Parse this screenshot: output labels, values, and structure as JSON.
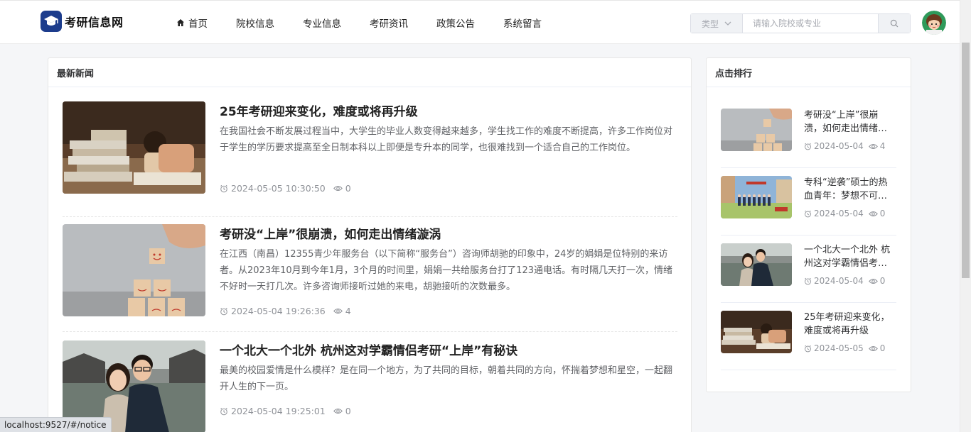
{
  "header": {
    "logo_text": "考研信息网",
    "nav": [
      {
        "label": "首页",
        "active": true
      },
      {
        "label": "院校信息"
      },
      {
        "label": "专业信息"
      },
      {
        "label": "考研资讯"
      },
      {
        "label": "政策公告"
      },
      {
        "label": "系统留言"
      }
    ],
    "search": {
      "type_label": "类型",
      "placeholder": "请输入院校或专业"
    }
  },
  "news": {
    "heading": "最新新闻",
    "items": [
      {
        "title": "25年考研迎来变化，难度或将再升级",
        "desc": "在我国社会不断发展过程当中，大学生的毕业人数变得越来越多，学生找工作的难度不断提高，许多工作岗位对于学生的学历要求提高至全日制本科以上即便是专升本的同学，也很难找到一个适合自己的工作岗位。",
        "time": "2024-05-05 10:30:50",
        "views": "0"
      },
      {
        "title": "考研没“上岸”很崩溃，如何走出情绪漩涡",
        "desc": "在江西（南昌）12355青少年服务台（以下简称“服务台”）咨询师胡驰的印象中，24岁的娟娟是位特别的来访者。从2023年10月到今年1月，3个月的时间里，娟娟一共给服务台打了123通电话。有时隔几天打一次，情绪不好时一天打几次。许多咨询师接听过她的来电，胡驰接听的次数最多。",
        "time": "2024-05-04 19:26:36",
        "views": "4"
      },
      {
        "title": "一个北大一个北外 杭州这对学霸情侣考研“上岸”有秘诀",
        "desc": "最美的校园爱情是什么模样？是在同一个地方，为了共同的目标，朝着共同的方向，怀揣着梦想和星空，一起翻开人生的下一页。",
        "time": "2024-05-04 19:25:01",
        "views": "0"
      }
    ]
  },
  "ranking": {
    "heading": "点击排行",
    "items": [
      {
        "title": "考研没“上岸”很崩溃，如何走出情绪漩涡",
        "date": "2024-05-04",
        "views": "4"
      },
      {
        "title": "专科“逆袭”硕士的热血青年：梦想不可辜负",
        "date": "2024-05-04",
        "views": "0"
      },
      {
        "title": "一个北大一个北外 杭州这对学霸情侣考研“上岸”有秘诀",
        "date": "2024-05-04",
        "views": "0"
      },
      {
        "title": "25年考研迎来变化，难度或将再升级",
        "date": "2024-05-05",
        "views": "0"
      }
    ]
  },
  "statusbar": {
    "url": "localhost:9527/#/notice"
  },
  "colors": {
    "brand": "#1c3c8c",
    "background": "#f5f6f8"
  }
}
